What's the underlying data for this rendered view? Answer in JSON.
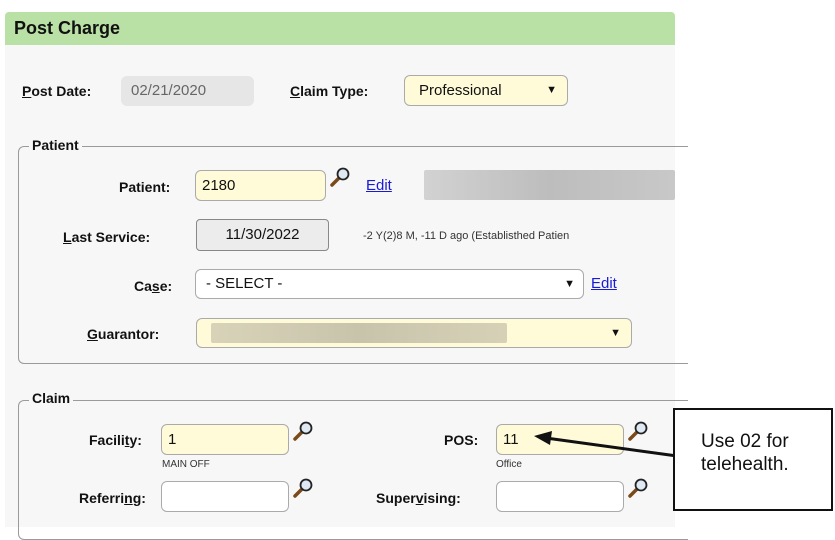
{
  "header": {
    "title": "Post Charge"
  },
  "post_date": {
    "label_accel": "P",
    "label_rest": "ost Date:",
    "value": "02/21/2020"
  },
  "claim_type": {
    "label_accel": "C",
    "label_rest": "laim Type:",
    "value": "Professional"
  },
  "patient_section": {
    "legend": "Patient",
    "patient": {
      "label": "Patient:",
      "value": "2180",
      "edit_label": "Edit"
    },
    "last_service": {
      "label_accel": "L",
      "label_rest": "ast Service:",
      "value": "11/30/2022",
      "note": "-2 Y(2)8 M, -11 D ago (Establisthed Patien"
    },
    "case": {
      "label_pre": "Ca",
      "label_accel": "s",
      "label_post": "e:",
      "value": "- SELECT -",
      "edit_label": "Edit"
    },
    "guarantor": {
      "label_accel": "G",
      "label_rest": "uarantor:"
    }
  },
  "claim_section": {
    "legend": "Claim",
    "facility": {
      "label_pre": "Facili",
      "label_accel": "t",
      "label_post": "y:",
      "value": "1",
      "sub": "MAIN OFF"
    },
    "pos": {
      "label": "POS:",
      "value": "11",
      "sub": "Office"
    },
    "referring": {
      "label_pre": "Referri",
      "label_accel": "n",
      "label_post": "g:",
      "value": ""
    },
    "supervising": {
      "label_pre": "Super",
      "label_accel": "v",
      "label_post": "ising:",
      "value": ""
    }
  },
  "callout": {
    "line1": "Use 02 for",
    "line2": "telehealth."
  },
  "icons": {
    "lookup": "magnifier-icon",
    "dropdown": "dropdown-arrow-icon"
  },
  "colors": {
    "header_bg": "#b9e0a5",
    "required_field_bg": "#fffbd9",
    "link": "#1a1ad6"
  }
}
